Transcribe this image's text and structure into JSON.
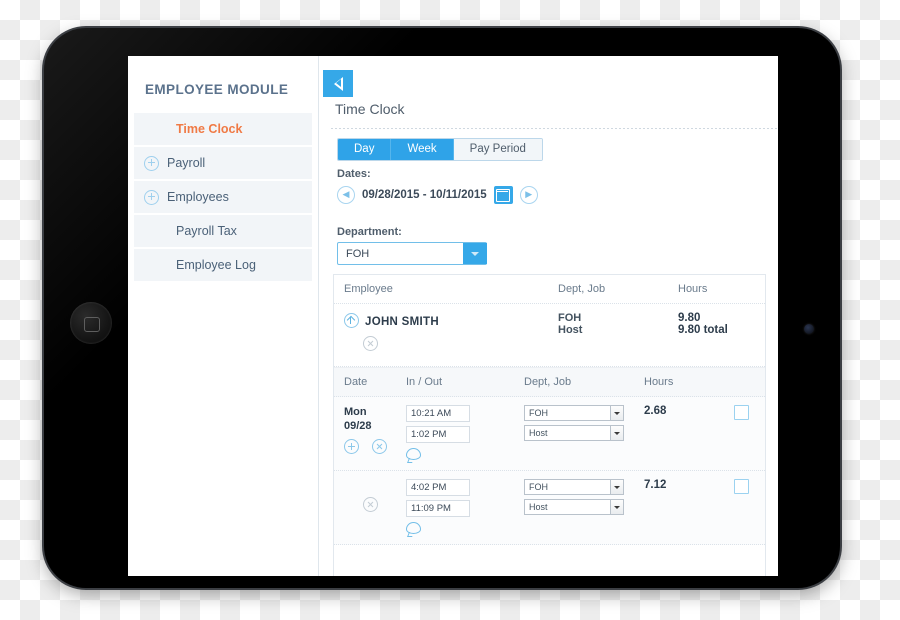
{
  "device": {
    "home_button": "home-button",
    "camera": "front-camera"
  },
  "sidebar": {
    "title": "EMPLOYEE MODULE",
    "items": [
      {
        "label": "Time Clock",
        "icon": "none",
        "active": true
      },
      {
        "label": "Payroll",
        "icon": "plus-icon",
        "active": false
      },
      {
        "label": "Employees",
        "icon": "plus-icon",
        "active": false
      },
      {
        "label": "Payroll Tax",
        "icon": "none",
        "active": false
      },
      {
        "label": "Employee Log",
        "icon": "none",
        "active": false
      }
    ]
  },
  "content": {
    "back_button": "back-arrow",
    "page_title": "Time Clock",
    "tabs": [
      {
        "label": "Day",
        "active": true
      },
      {
        "label": "Week",
        "active": true
      },
      {
        "label": "Pay Period",
        "active": false
      }
    ],
    "dates": {
      "label": "Dates:",
      "prev_icon": "arrow-left-circle-icon",
      "range": "09/28/2015 - 10/11/2015",
      "calendar_icon": "calendar-icon",
      "next_icon": "arrow-right-circle-icon"
    },
    "department": {
      "label": "Department:",
      "value": "FOH",
      "caret_icon": "chevron-down-icon"
    }
  },
  "table": {
    "employee_headers": [
      "Employee",
      "Dept, Job",
      "Hours"
    ],
    "employee_row": {
      "collapse_icon": "arrow-up-circle-icon",
      "name": "JOHN SMITH",
      "delete_icon": "close-circle-icon",
      "dept": "FOH",
      "job": "Host",
      "hours": "9.80",
      "hours_total": "9.80 total",
      "checkbox": "row-checkbox"
    },
    "detail_headers": [
      "Date",
      "In / Out",
      "Dept, Job",
      "Hours"
    ],
    "detail_rows": [
      {
        "day": "Mon",
        "date": "09/28",
        "add_icon": "plus-circle-icon",
        "delete_icon": "close-circle-icon",
        "time_in": "10:21 AM",
        "time_out": "1:02 PM",
        "dept": "FOH",
        "job": "Host",
        "hours": "2.68",
        "comment_icon": "comment-bubble-icon",
        "checkbox": "row-checkbox"
      },
      {
        "day": "",
        "date": "",
        "add_icon": "",
        "delete_icon": "close-circle-icon",
        "time_in": "4:02 PM",
        "time_out": "11:09 PM",
        "dept": "FOH",
        "job": "Host",
        "hours": "7.12",
        "comment_icon": "comment-bubble-icon",
        "checkbox": "row-checkbox"
      }
    ]
  },
  "colors": {
    "accent_blue": "#2fa3e8",
    "active_orange": "#f07a45",
    "sidebar_item_bg": "#f2f5f8",
    "text_dark": "#2d3c4b"
  }
}
